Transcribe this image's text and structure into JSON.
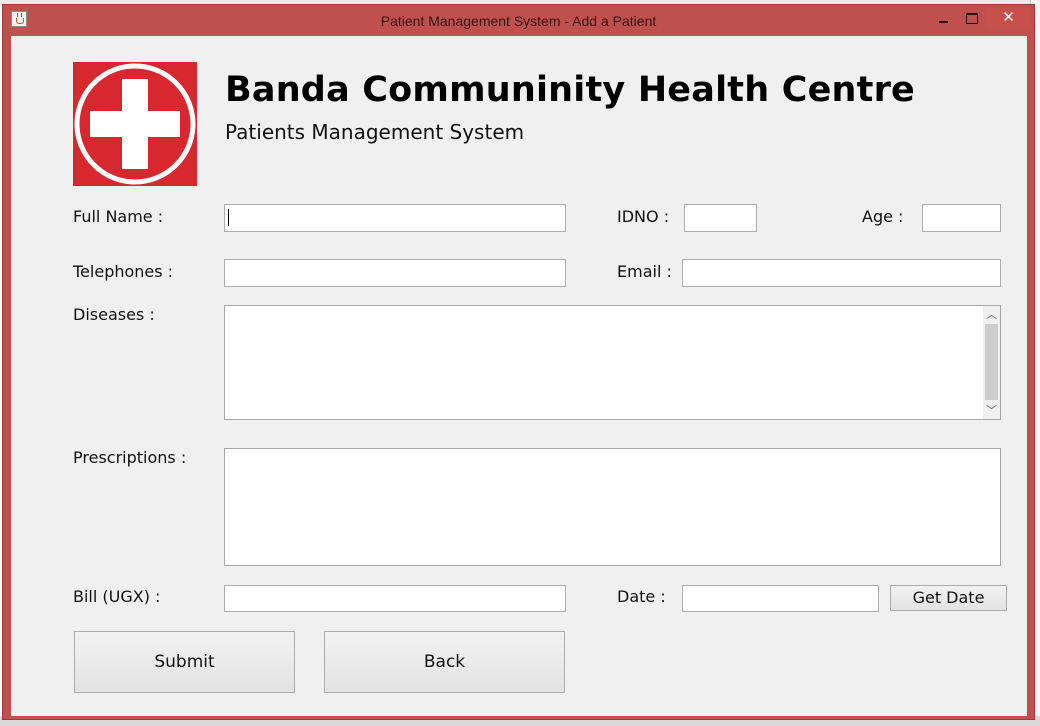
{
  "window": {
    "title": "Patient Management System - Add a Patient",
    "close_glyph": "✕"
  },
  "header": {
    "logo_icon": "red-cross-icon",
    "logo_color": "#d7282f",
    "title": "Banda Communinity Health Centre",
    "subtitle": "Patients Management System"
  },
  "form": {
    "full_name_label": "Full Name :",
    "full_name_value": "",
    "idno_label": "IDNO :",
    "idno_value": "",
    "age_label": "Age :",
    "age_value": "",
    "telephones_label": "Telephones :",
    "telephones_value": "",
    "email_label": "Email :",
    "email_value": "",
    "diseases_label": "Diseases :",
    "diseases_value": "",
    "prescriptions_label": "Prescriptions :",
    "prescriptions_value": "",
    "bill_label": "Bill (UGX) :",
    "bill_value": "",
    "date_label": "Date :",
    "date_value": "",
    "get_date_label": "Get Date"
  },
  "actions": {
    "submit_label": "Submit",
    "back_label": "Back"
  },
  "colors": {
    "window_frame": "#c0504d",
    "client_bg": "#f0f0f0",
    "accent_red": "#d7282f"
  }
}
